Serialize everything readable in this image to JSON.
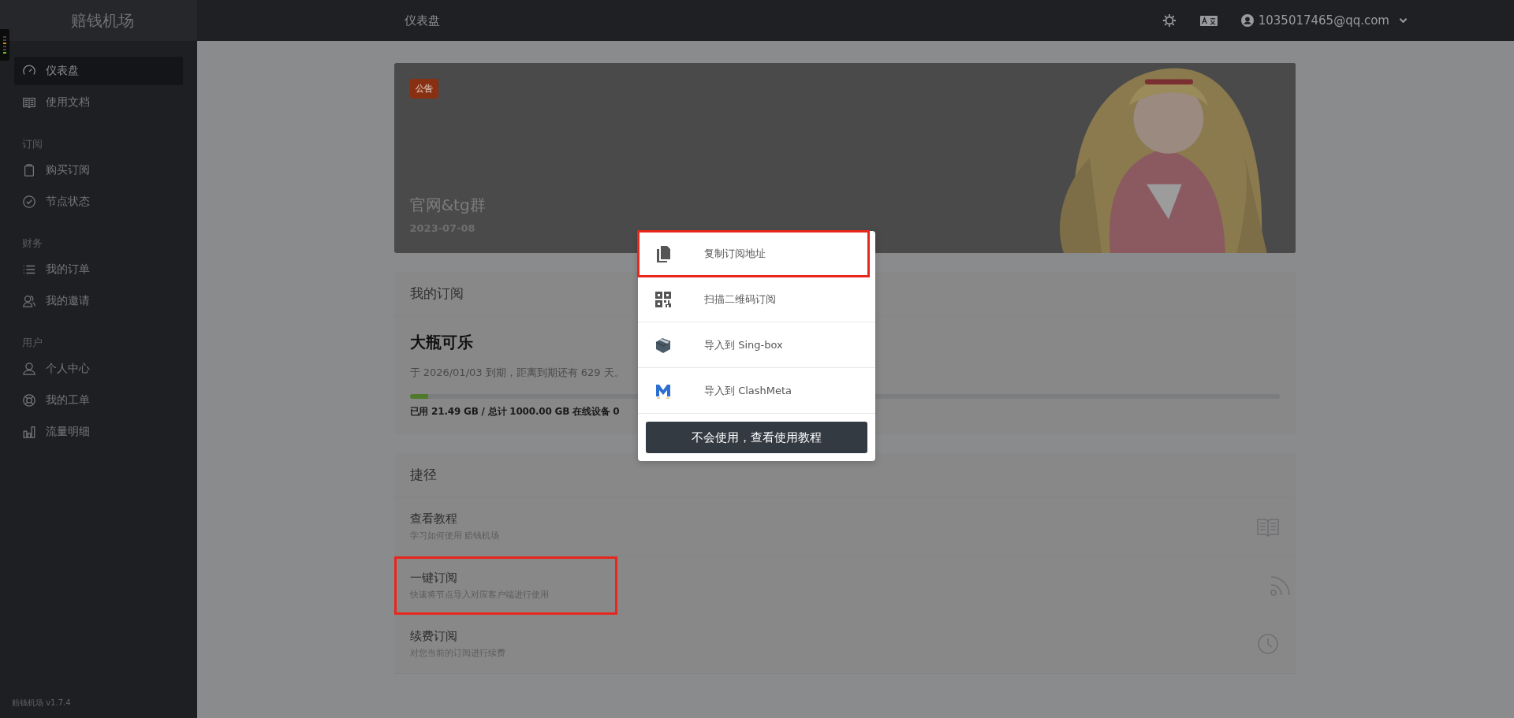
{
  "sidebar": {
    "brand": "赔钱机场",
    "version": "赔钱机场 v1.7.4",
    "sections": [
      {
        "items": [
          {
            "label": "仪表盘",
            "selected": true
          },
          {
            "label": "使用文档",
            "selected": false
          }
        ]
      },
      {
        "title": "订阅",
        "items": [
          {
            "label": "购买订阅",
            "selected": false
          },
          {
            "label": "节点状态",
            "selected": false
          }
        ]
      },
      {
        "title": "财务",
        "items": [
          {
            "label": "我的订单",
            "selected": false
          },
          {
            "label": "我的邀请",
            "selected": false
          }
        ]
      },
      {
        "title": "用户",
        "items": [
          {
            "label": "个人中心",
            "selected": false
          },
          {
            "label": "我的工单",
            "selected": false
          },
          {
            "label": "流量明细",
            "selected": false
          }
        ]
      }
    ]
  },
  "header": {
    "title": "仪表盘",
    "account": "1035017465@qq.com"
  },
  "announcement": {
    "tag": "公告",
    "title": "官网&tg群",
    "date": "2023-07-08"
  },
  "subscription": {
    "heading": "我的订阅",
    "plan": "大瓶可乐",
    "expiry": "于 2026/01/03 到期，距离到期还有 629 天。",
    "usage": {
      "level": 0.0215,
      "text": "已用 21.49 GB / 总计 1000.00 GB 在线设备 0"
    }
  },
  "shortcuts": {
    "heading": "捷径",
    "items": [
      {
        "title": "查看教程",
        "subtitle": "学习如何使用 赔钱机场",
        "highlighted": false
      },
      {
        "title": "一键订阅",
        "subtitle": "快速将节点导入对应客户端进行使用",
        "highlighted": true
      },
      {
        "title": "续费订阅",
        "subtitle": "对您当前的订阅进行续费",
        "highlighted": false
      }
    ]
  },
  "popup": {
    "items": [
      {
        "label": "复制订阅地址",
        "highlighted": true
      },
      {
        "label": "扫描二维码订阅",
        "highlighted": false
      },
      {
        "label": "导入到 Sing-box",
        "highlighted": false
      },
      {
        "label": "导入到 ClashMeta",
        "highlighted": false
      }
    ],
    "button": "不会使用，查看使用教程"
  }
}
